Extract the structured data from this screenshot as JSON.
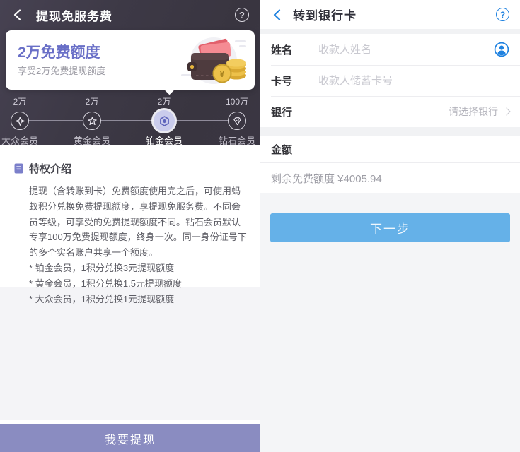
{
  "left_screen": {
    "header": {
      "title": "提现免服务费",
      "help_label": "?"
    },
    "quota_card": {
      "title": "2万免费额度",
      "subtitle": "享受2万免费提现额度"
    },
    "progress": {
      "milestones": [
        {
          "amount": "2万",
          "level": "大众会员",
          "icon": "sparkle-icon",
          "active": false
        },
        {
          "amount": "2万",
          "level": "黄金会员",
          "icon": "star-icon",
          "active": false
        },
        {
          "amount": "2万",
          "level": "铂金会员",
          "icon": "hexagon-icon",
          "active": true
        },
        {
          "amount": "100万",
          "level": "钻石会员",
          "icon": "gem-icon",
          "active": false
        }
      ]
    },
    "privileges": {
      "title": "特权介绍",
      "body": "提现（含转账到卡）免费额度使用完之后，可使用蚂蚁积分兑换免费提现额度，享提现免服务费。不同会员等级，可享受的免费提现额度不同。钻石会员默认专享100万免费提现额度，终身一次。同一身份证号下的多个实名账户共享一个额度。",
      "notes": [
        "* 铂金会员，1积分兑换3元提现额度",
        "* 黄金会员，1积分兑换1.5元提现额度",
        "* 大众会员，1积分兑换1元提现额度"
      ]
    },
    "withdraw_button": "我要提现"
  },
  "right_screen": {
    "header": {
      "title": "转到银行卡",
      "help_label": "?"
    },
    "form": {
      "name_label": "姓名",
      "name_placeholder": "收款人姓名",
      "card_label": "卡号",
      "card_placeholder": "收款人储蓄卡号",
      "bank_label": "银行",
      "bank_value": "请选择银行",
      "amount_label": "金额",
      "remaining_quota": "剩余免费额度 ¥4005.94"
    },
    "next_button": "下一步"
  },
  "colors": {
    "dark_bg": "#3b3743",
    "accent_purple": "#696fc7",
    "withdraw_button_purple": "#8a8cc1",
    "accent_blue": "#1f82e0",
    "next_button_blue": "#65b1e8"
  }
}
